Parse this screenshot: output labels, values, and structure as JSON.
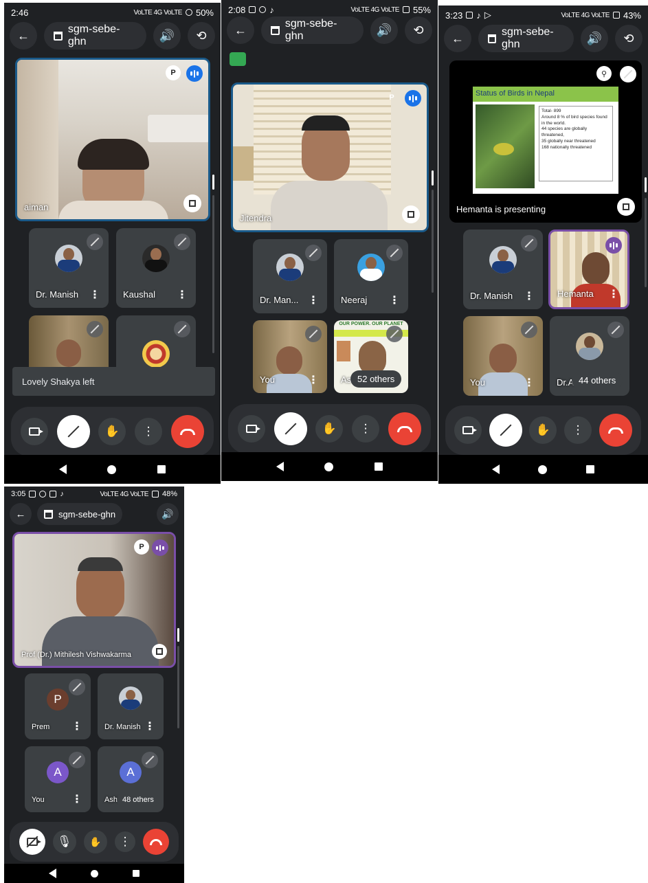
{
  "phones": [
    {
      "status": {
        "time": "2:46",
        "network": "VoLTE 4G VoLTE",
        "battery": "50%"
      },
      "meeting_code": "sgm-sebe-ghn",
      "main_tile_name": "aiman",
      "tiles": [
        {
          "name": "Dr. Manish"
        },
        {
          "name": "Kaushal"
        }
      ],
      "toast": "Lovely Shakya left"
    },
    {
      "status": {
        "time": "2:08",
        "network": "VoLTE 4G VoLTE",
        "battery": "55%"
      },
      "meeting_code": "sgm-sebe-ghn",
      "main_tile_name": "Jitendra",
      "tiles": [
        {
          "name": "Dr. Man..."
        },
        {
          "name": "Neeraj"
        },
        {
          "name": "You"
        },
        {
          "name": "As"
        }
      ],
      "others": "52 others",
      "banner_text": "OUR POWER. OUR PLANET"
    },
    {
      "status": {
        "time": "3:23",
        "network": "VoLTE 4G VoLTE",
        "battery": "43%"
      },
      "meeting_code": "sgm-sebe-ghn",
      "presentation": {
        "title": "Status of Birds in Nepal",
        "lines": [
          "Total- 899",
          "Around 8 % of bird species found in the world.",
          "44 species are globally threatened,",
          "35 globally near threatened",
          "168 nationally threatened"
        ],
        "presenting": "Hemanta is presenting"
      },
      "tiles": [
        {
          "name": "Dr. Manish"
        },
        {
          "name": "Hemanta"
        },
        {
          "name": "You"
        },
        {
          "name": "Dr.A"
        }
      ],
      "others": "44 others"
    },
    {
      "status": {
        "time": "3:05",
        "network": "VoLTE 4G VoLTE",
        "battery": "48%"
      },
      "meeting_code": "sgm-sebe-ghn",
      "main_tile_name": "Prof (Dr.) Mithilesh Vishwakarma",
      "tiles": [
        {
          "name": "Prem",
          "initial": "P",
          "color": "#6b3e2e"
        },
        {
          "name": "Dr. Manish"
        },
        {
          "name": "You",
          "initial": "A",
          "color": "#7b57c9"
        },
        {
          "name": "Ashi",
          "initial": "A",
          "color": "#5b6fd6"
        }
      ],
      "others": "48 others"
    }
  ],
  "colors": {
    "end_call": "#ea4335",
    "speaking": "#1a73e8",
    "bg": "#1f2124"
  },
  "icons": [
    "back-arrow-icon",
    "calendar-icon",
    "speaker-icon",
    "switch-camera-icon",
    "mic-off-icon",
    "raise-hand-icon",
    "more-vert-icon",
    "end-call-icon",
    "camera-icon",
    "expand-icon",
    "pin-icon"
  ]
}
